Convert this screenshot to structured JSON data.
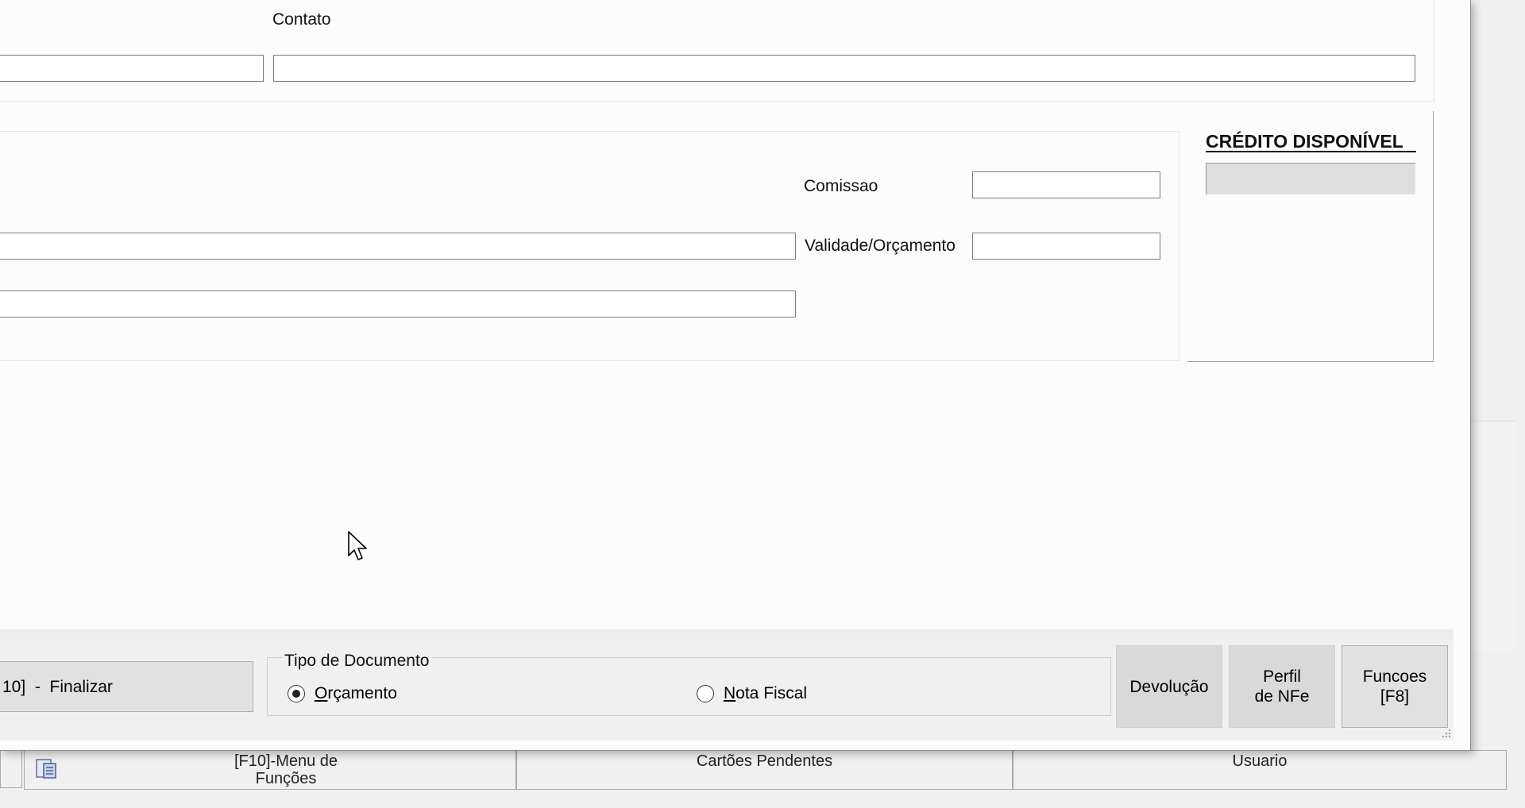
{
  "form": {
    "contato_label": "Contato",
    "contato_value": "",
    "left_top_value": "",
    "comissao_label": "Comissao",
    "comissao_value": "",
    "validade_label": "Validade/Orçamento",
    "validade_value": "",
    "field_a_value": "",
    "field_b_value": ""
  },
  "credit": {
    "title": "CRÉDITO DISPONÍVEL",
    "value": ""
  },
  "bottom": {
    "finalizar_label": "10]  -  Finalizar",
    "tipo_documento_label": "Tipo de Documento",
    "orcamento": {
      "first": "O",
      "rest": "rçamento",
      "selected": true
    },
    "nota_fiscal": {
      "first": "N",
      "rest": "ota Fiscal",
      "selected": false
    },
    "devolucao_label": "Devolução",
    "perfil_line1": "Perfil",
    "perfil_line2": "de NFe",
    "funcoes_line1": "Funcoes",
    "funcoes_line2": "[F8]"
  },
  "background_app": {
    "menu_line1": "[F10]-Menu de",
    "menu_line2": "Funções",
    "cartoes_label": "Cartões Pendentes",
    "usuario_label": "Usuario"
  },
  "icons": [
    "menu-functions-icon",
    "mouse-cursor-icon",
    "resize-grip-icon"
  ]
}
